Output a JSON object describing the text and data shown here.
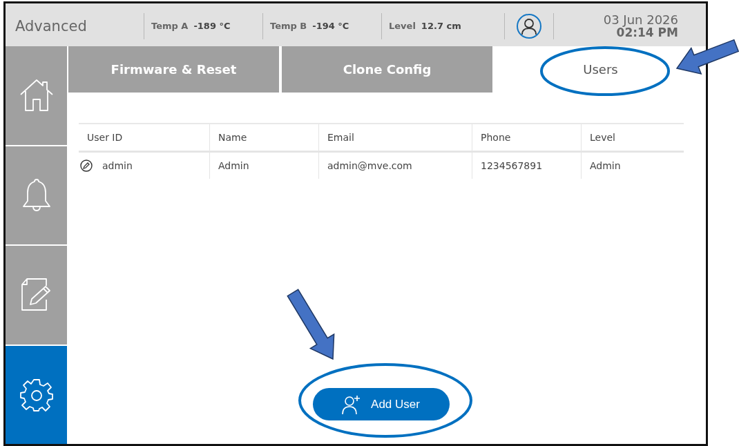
{
  "header": {
    "title": "Advanced",
    "readings": [
      {
        "label": "Temp A",
        "value": "-189 °C"
      },
      {
        "label": "Temp B",
        "value": "-194 °C"
      },
      {
        "label": "Level",
        "value": "12.7 cm"
      }
    ],
    "date": "03 Jun 2026",
    "time": "02:14 PM"
  },
  "sidebar": {
    "items": [
      {
        "kind": "home",
        "selected": false
      },
      {
        "kind": "alarms",
        "selected": false
      },
      {
        "kind": "notes",
        "selected": false
      },
      {
        "kind": "settings",
        "selected": true
      }
    ]
  },
  "tabs": [
    {
      "label": "Firmware & Reset",
      "selected": false
    },
    {
      "label": "Clone Config",
      "selected": false
    },
    {
      "label": "Users",
      "selected": true
    }
  ],
  "table": {
    "columns": [
      "User ID",
      "Name",
      "Email",
      "Phone",
      "Level"
    ],
    "rows": [
      {
        "cells": [
          "admin",
          "Admin",
          "admin@mve.com",
          "1234567891",
          "Admin"
        ]
      }
    ]
  },
  "add_button": {
    "label": "Add User"
  }
}
